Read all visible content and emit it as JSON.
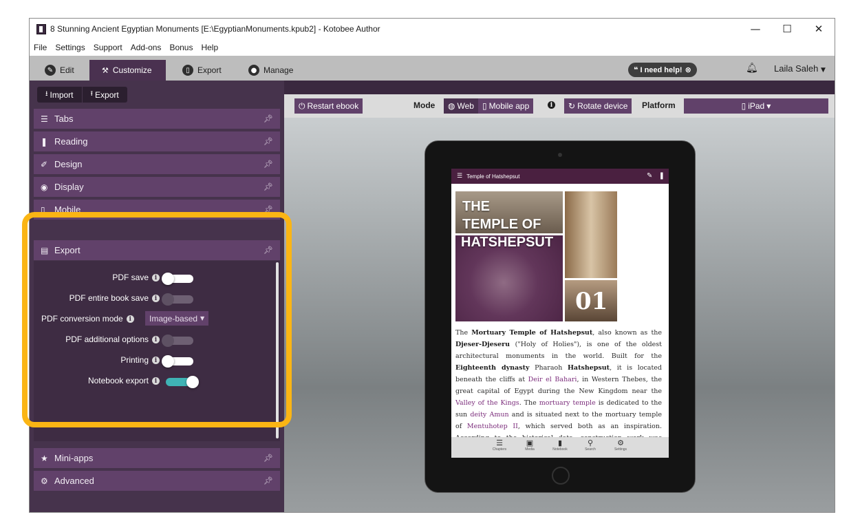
{
  "window": {
    "title": "8 Stunning Ancient Egyptian Monuments [E:\\EgyptianMonuments.kpub2] - Kotobee Author",
    "controls": {
      "minimize": "—",
      "maximize": "☐",
      "close": "✕"
    }
  },
  "menu": [
    "File",
    "Settings",
    "Support",
    "Add-ons",
    "Bonus",
    "Help"
  ],
  "top_tabs": [
    {
      "label": "Edit",
      "icon": "pencil-icon",
      "active": false
    },
    {
      "label": "Customize",
      "icon": "wrench-icon",
      "active": true
    },
    {
      "label": "Export",
      "icon": "tablet-icon",
      "active": false
    },
    {
      "label": "Manage",
      "icon": "user-icon",
      "active": false
    }
  ],
  "help_button": "I need help!",
  "user": "Laila Saleh",
  "sidebar": {
    "actions": {
      "import": "Import",
      "export": "Export"
    },
    "panels": {
      "tabs": "Tabs",
      "reading": "Reading",
      "design": "Design",
      "display": "Display",
      "mobile": "Mobile",
      "export": "Export",
      "mini_apps": "Mini-apps",
      "advanced": "Advanced"
    },
    "export_options": {
      "pdf_save": {
        "label": "PDF save",
        "state": "off"
      },
      "pdf_entire_book_save": {
        "label": "PDF entire book save",
        "state": "disabled"
      },
      "pdf_conversion_mode": {
        "label": "PDF conversion mode",
        "value": "Image-based"
      },
      "pdf_additional_options": {
        "label": "PDF additional options",
        "state": "disabled"
      },
      "printing": {
        "label": "Printing",
        "state": "off"
      },
      "notebook_export": {
        "label": "Notebook export",
        "state": "on"
      }
    },
    "highlight_color": "#fbb514"
  },
  "preview": {
    "restart": "Restart ebook",
    "mode_label": "Mode",
    "modes": {
      "web": "Web",
      "mobile_app": "Mobile app"
    },
    "rotate": "Rotate device",
    "platform_label": "Platform",
    "platform_value": "iPad"
  },
  "ebook": {
    "header_title": "Temple of Hatshepsut",
    "hero": {
      "line1": "THE",
      "line2": "TEMPLE OF",
      "line3": "HATSHEPSUT",
      "number": "01"
    },
    "footer": {
      "chapters": "Chapters",
      "media": "Media",
      "notebook": "Notebook",
      "search": "Search",
      "settings": "Settings"
    }
  },
  "colors": {
    "purple": "#61416a",
    "dark_purple": "#46334c",
    "toggle_on": "#3fb3b5"
  }
}
